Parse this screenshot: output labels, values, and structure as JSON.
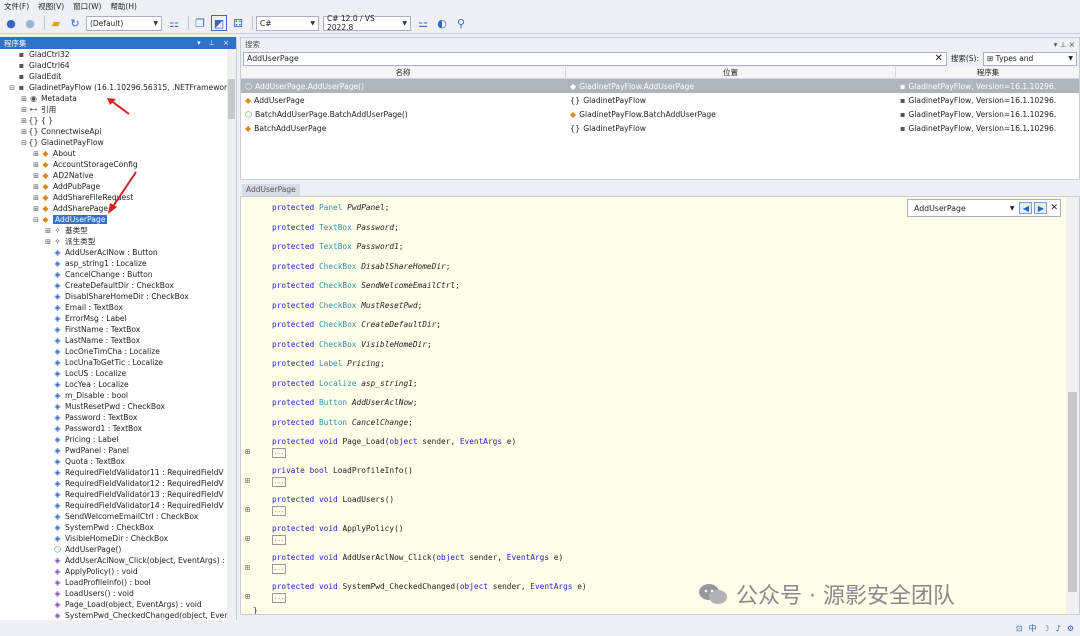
{
  "menu": [
    "文件(F)",
    "视图(V)",
    "窗口(W)",
    "帮助(H)"
  ],
  "toolbar": {
    "view_select": "(Default)",
    "language_select": "C#",
    "version_select": "C# 12.0 / VS 2022.8"
  },
  "tree": {
    "title": "程序集",
    "rows": [
      {
        "indent": 0,
        "exp": "",
        "icon": "assembly-icon",
        "glyph": "▪",
        "cls": "ic-asm",
        "label": "GladCtrl32"
      },
      {
        "indent": 0,
        "exp": "",
        "icon": "assembly-icon",
        "glyph": "▪",
        "cls": "ic-asm",
        "label": "GladCtrl64"
      },
      {
        "indent": 0,
        "exp": "",
        "icon": "assembly-icon",
        "glyph": "▪",
        "cls": "ic-asm",
        "label": "GladEdit"
      },
      {
        "indent": 0,
        "exp": "⊟",
        "icon": "assembly-icon",
        "glyph": "▪",
        "cls": "ic-asm",
        "label": "GladinetPayFlow (16.1.10296.56315, .NETFramework"
      },
      {
        "indent": 1,
        "exp": "⊞",
        "icon": "metadata-icon",
        "glyph": "◉",
        "cls": "ic-asm",
        "label": "Metadata"
      },
      {
        "indent": 1,
        "exp": "⊞",
        "icon": "references-icon",
        "glyph": "⊷",
        "cls": "ic-asm",
        "label": "引用"
      },
      {
        "indent": 1,
        "exp": "⊞",
        "icon": "namespace-icon",
        "glyph": "{}",
        "cls": "ic-ns",
        "label": "{ }"
      },
      {
        "indent": 1,
        "exp": "⊞",
        "icon": "namespace-icon",
        "glyph": "{}",
        "cls": "ic-ns",
        "label": "ConnectwiseApi"
      },
      {
        "indent": 1,
        "exp": "⊟",
        "icon": "namespace-icon",
        "glyph": "{}",
        "cls": "ic-ns",
        "label": "GladinetPayFlow"
      },
      {
        "indent": 2,
        "exp": "⊞",
        "icon": "class-icon",
        "glyph": "◆",
        "cls": "ic-cls",
        "label": "About"
      },
      {
        "indent": 2,
        "exp": "⊞",
        "icon": "class-icon",
        "glyph": "◆",
        "cls": "ic-cls",
        "label": "AccountStorageConfig"
      },
      {
        "indent": 2,
        "exp": "⊞",
        "icon": "class-icon",
        "glyph": "◆",
        "cls": "ic-cls",
        "label": "AD2Native"
      },
      {
        "indent": 2,
        "exp": "⊞",
        "icon": "class-icon",
        "glyph": "◆",
        "cls": "ic-cls",
        "label": "AddPubPage"
      },
      {
        "indent": 2,
        "exp": "⊞",
        "icon": "class-icon",
        "glyph": "◆",
        "cls": "ic-cls",
        "label": "AddShareFileRequest"
      },
      {
        "indent": 2,
        "exp": "⊞",
        "icon": "class-icon",
        "glyph": "◆",
        "cls": "ic-cls",
        "label": "AddSharePage"
      },
      {
        "indent": 2,
        "exp": "⊟",
        "icon": "class-icon",
        "glyph": "◆",
        "cls": "ic-cls",
        "label": "AddUserPage",
        "selected": true
      },
      {
        "indent": 3,
        "exp": "⊞",
        "icon": "base-types-icon",
        "glyph": "✧",
        "cls": "ic-asm",
        "label": "基类型"
      },
      {
        "indent": 3,
        "exp": "⊞",
        "icon": "derived-types-icon",
        "glyph": "✧",
        "cls": "ic-asm",
        "label": "派生类型"
      },
      {
        "indent": 3,
        "exp": "",
        "icon": "field-icon",
        "glyph": "◈",
        "cls": "ic-fld",
        "label": "AddUserAclNow : Button"
      },
      {
        "indent": 3,
        "exp": "",
        "icon": "field-icon",
        "glyph": "◈",
        "cls": "ic-fld",
        "label": "asp_string1 : Localize"
      },
      {
        "indent": 3,
        "exp": "",
        "icon": "field-icon",
        "glyph": "◈",
        "cls": "ic-fld",
        "label": "CancelChange : Button"
      },
      {
        "indent": 3,
        "exp": "",
        "icon": "field-icon",
        "glyph": "◈",
        "cls": "ic-fld",
        "label": "CreateDefaultDir : CheckBox"
      },
      {
        "indent": 3,
        "exp": "",
        "icon": "field-icon",
        "glyph": "◈",
        "cls": "ic-fld",
        "label": "DisablShareHomeDir : CheckBox"
      },
      {
        "indent": 3,
        "exp": "",
        "icon": "field-icon",
        "glyph": "◈",
        "cls": "ic-fld",
        "label": "Email : TextBox"
      },
      {
        "indent": 3,
        "exp": "",
        "icon": "field-icon",
        "glyph": "◈",
        "cls": "ic-fld",
        "label": "ErrorMsg : Label"
      },
      {
        "indent": 3,
        "exp": "",
        "icon": "field-icon",
        "glyph": "◈",
        "cls": "ic-fld",
        "label": "FirstName : TextBox"
      },
      {
        "indent": 3,
        "exp": "",
        "icon": "field-icon",
        "glyph": "◈",
        "cls": "ic-fld",
        "label": "LastName : TextBox"
      },
      {
        "indent": 3,
        "exp": "",
        "icon": "field-icon",
        "glyph": "◈",
        "cls": "ic-fld",
        "label": "LocOneTimCha : Localize"
      },
      {
        "indent": 3,
        "exp": "",
        "icon": "field-icon",
        "glyph": "◈",
        "cls": "ic-fld",
        "label": "LocUnaToGetTic : Localize"
      },
      {
        "indent": 3,
        "exp": "",
        "icon": "field-icon",
        "glyph": "◈",
        "cls": "ic-fld",
        "label": "LocUS : Localize"
      },
      {
        "indent": 3,
        "exp": "",
        "icon": "field-icon",
        "glyph": "◈",
        "cls": "ic-fld",
        "label": "LocYea : Localize"
      },
      {
        "indent": 3,
        "exp": "",
        "icon": "field-icon",
        "glyph": "◈",
        "cls": "ic-fld",
        "label": "m_Disable : bool"
      },
      {
        "indent": 3,
        "exp": "",
        "icon": "field-icon",
        "glyph": "◈",
        "cls": "ic-fld",
        "label": "MustResetPwd : CheckBox"
      },
      {
        "indent": 3,
        "exp": "",
        "icon": "field-icon",
        "glyph": "◈",
        "cls": "ic-fld",
        "label": "Password : TextBox"
      },
      {
        "indent": 3,
        "exp": "",
        "icon": "field-icon",
        "glyph": "◈",
        "cls": "ic-fld",
        "label": "Password1 : TextBox"
      },
      {
        "indent": 3,
        "exp": "",
        "icon": "field-icon",
        "glyph": "◈",
        "cls": "ic-fld",
        "label": "Pricing : Label"
      },
      {
        "indent": 3,
        "exp": "",
        "icon": "field-icon",
        "glyph": "◈",
        "cls": "ic-fld",
        "label": "PwdPanel : Panel"
      },
      {
        "indent": 3,
        "exp": "",
        "icon": "field-icon",
        "glyph": "◈",
        "cls": "ic-fld",
        "label": "Quota : TextBox"
      },
      {
        "indent": 3,
        "exp": "",
        "icon": "field-icon",
        "glyph": "◈",
        "cls": "ic-fld",
        "label": "RequiredFieldValidator11 : RequiredFieldV"
      },
      {
        "indent": 3,
        "exp": "",
        "icon": "field-icon",
        "glyph": "◈",
        "cls": "ic-fld",
        "label": "RequiredFieldValidator12 : RequiredFieldV"
      },
      {
        "indent": 3,
        "exp": "",
        "icon": "field-icon",
        "glyph": "◈",
        "cls": "ic-fld",
        "label": "RequiredFieldValidator13 : RequiredFieldV"
      },
      {
        "indent": 3,
        "exp": "",
        "icon": "field-icon",
        "glyph": "◈",
        "cls": "ic-fld",
        "label": "RequiredFieldValidator14 : RequiredFieldV"
      },
      {
        "indent": 3,
        "exp": "",
        "icon": "field-icon",
        "glyph": "◈",
        "cls": "ic-fld",
        "label": "SendWelcomeEmailCtrl : CheckBox"
      },
      {
        "indent": 3,
        "exp": "",
        "icon": "field-icon",
        "glyph": "◈",
        "cls": "ic-fld",
        "label": "SystemPwd : CheckBox"
      },
      {
        "indent": 3,
        "exp": "",
        "icon": "field-icon",
        "glyph": "◈",
        "cls": "ic-fld",
        "label": "VisibleHomeDir : CheckBox"
      },
      {
        "indent": 3,
        "exp": "",
        "icon": "constructor-icon",
        "glyph": "⬡",
        "cls": "ic-evt",
        "label": "AddUserPage()"
      },
      {
        "indent": 3,
        "exp": "",
        "icon": "method-icon",
        "glyph": "◈",
        "cls": "ic-meth",
        "label": "AddUserAclNow_Click(object, EventArgs) :"
      },
      {
        "indent": 3,
        "exp": "",
        "icon": "method-icon",
        "glyph": "◈",
        "cls": "ic-meth",
        "label": "ApplyPolicy() : void"
      },
      {
        "indent": 3,
        "exp": "",
        "icon": "method-icon",
        "glyph": "◈",
        "cls": "ic-meth",
        "label": "LoadProfileInfo() : bool"
      },
      {
        "indent": 3,
        "exp": "",
        "icon": "method-icon",
        "glyph": "◈",
        "cls": "ic-meth",
        "label": "LoadUsers() : void"
      },
      {
        "indent": 3,
        "exp": "",
        "icon": "method-icon",
        "glyph": "◈",
        "cls": "ic-meth",
        "label": "Page_Load(object, EventArgs) : void"
      },
      {
        "indent": 3,
        "exp": "",
        "icon": "method-icon",
        "glyph": "◈",
        "cls": "ic-meth",
        "label": "SystemPwd_CheckedChanged(object, Even"
      }
    ]
  },
  "search": {
    "title": "搜索",
    "query": "AddUserPage",
    "scope_label": "搜索(S):",
    "scope_value": "Types and",
    "columns": [
      "名称",
      "位置",
      "程序集"
    ],
    "rows": [
      {
        "name": "AddUserPage.AddUserPage()",
        "name_icon": "constructor-icon",
        "name_glyph": "⬡",
        "loc": "GladinetPayFlow.AddUserPage",
        "loc_icon": "class-icon",
        "loc_glyph": "◆",
        "asm": "GladinetPayFlow, Version=16.1.10296.",
        "selected": true
      },
      {
        "name": "AddUserPage",
        "name_icon": "class-icon",
        "name_glyph": "◆",
        "loc": "GladinetPayFlow",
        "loc_icon": "namespace-icon",
        "loc_glyph": "{}",
        "asm": "GladinetPayFlow, Version=16.1.10296."
      },
      {
        "name": "BatchAddUserPage.BatchAddUserPage()",
        "name_icon": "constructor-icon",
        "name_glyph": "⬡",
        "loc": "GladinetPayFlow.BatchAddUserPage",
        "loc_icon": "class-icon",
        "loc_glyph": "◆",
        "asm": "GladinetPayFlow, Version=16.1.10296."
      },
      {
        "name": "BatchAddUserPage",
        "name_icon": "class-icon",
        "name_glyph": "◆",
        "loc": "GladinetPayFlow",
        "loc_icon": "namespace-icon",
        "loc_glyph": "{}",
        "asm": "GladinetPayFlow, Version=16.1.10296."
      }
    ]
  },
  "editor": {
    "tab": "AddUserPage",
    "find_value": "AddUserPage",
    "fields": [
      {
        "kw": "protected",
        "type": "Panel",
        "name": "PwdPanel"
      },
      {
        "kw": "protected",
        "type": "TextBox",
        "name": "Password"
      },
      {
        "kw": "protected",
        "type": "TextBox",
        "name": "Password1"
      },
      {
        "kw": "protected",
        "type": "CheckBox",
        "name": "DisablShareHomeDir"
      },
      {
        "kw": "protected",
        "type": "CheckBox",
        "name": "SendWelcomeEmailCtrl"
      },
      {
        "kw": "protected",
        "type": "CheckBox",
        "name": "MustResetPwd"
      },
      {
        "kw": "protected",
        "type": "CheckBox",
        "name": "CreateDefaultDir"
      },
      {
        "kw": "protected",
        "type": "CheckBox",
        "name": "VisibleHomeDir"
      },
      {
        "kw": "protected",
        "type": "Label",
        "name": "Pricing"
      },
      {
        "kw": "protected",
        "type": "Localize",
        "name": "asp_string1"
      },
      {
        "kw": "protected",
        "type": "Button",
        "name": "AddUserAclNow"
      },
      {
        "kw": "protected",
        "type": "Button",
        "name": "CancelChange"
      }
    ],
    "methods": [
      {
        "kw": "protected",
        "ret": "void",
        "name": "Page_Load",
        "params": [
          [
            "object",
            "sender"
          ],
          [
            "EventArgs",
            "e"
          ]
        ]
      },
      {
        "kw": "private",
        "ret": "bool",
        "name": "LoadProfileInfo",
        "params": []
      },
      {
        "kw": "protected",
        "ret": "void",
        "name": "LoadUsers",
        "params": []
      },
      {
        "kw": "protected",
        "ret": "void",
        "name": "ApplyPolicy",
        "params": []
      },
      {
        "kw": "protected",
        "ret": "void",
        "name": "AddUserAclNow_Click",
        "params": [
          [
            "object",
            "sender"
          ],
          [
            "EventArgs",
            "e"
          ]
        ]
      },
      {
        "kw": "protected",
        "ret": "void",
        "name": "SystemPwd_CheckedChanged",
        "params": [
          [
            "object",
            "sender"
          ],
          [
            "EventArgs",
            "e"
          ]
        ]
      }
    ],
    "ellipsis": "...",
    "closing_brace": "}"
  },
  "watermark": "公众号 · 源影安全团队",
  "status_icons": [
    "中",
    "☽",
    "♪",
    "⚙"
  ]
}
